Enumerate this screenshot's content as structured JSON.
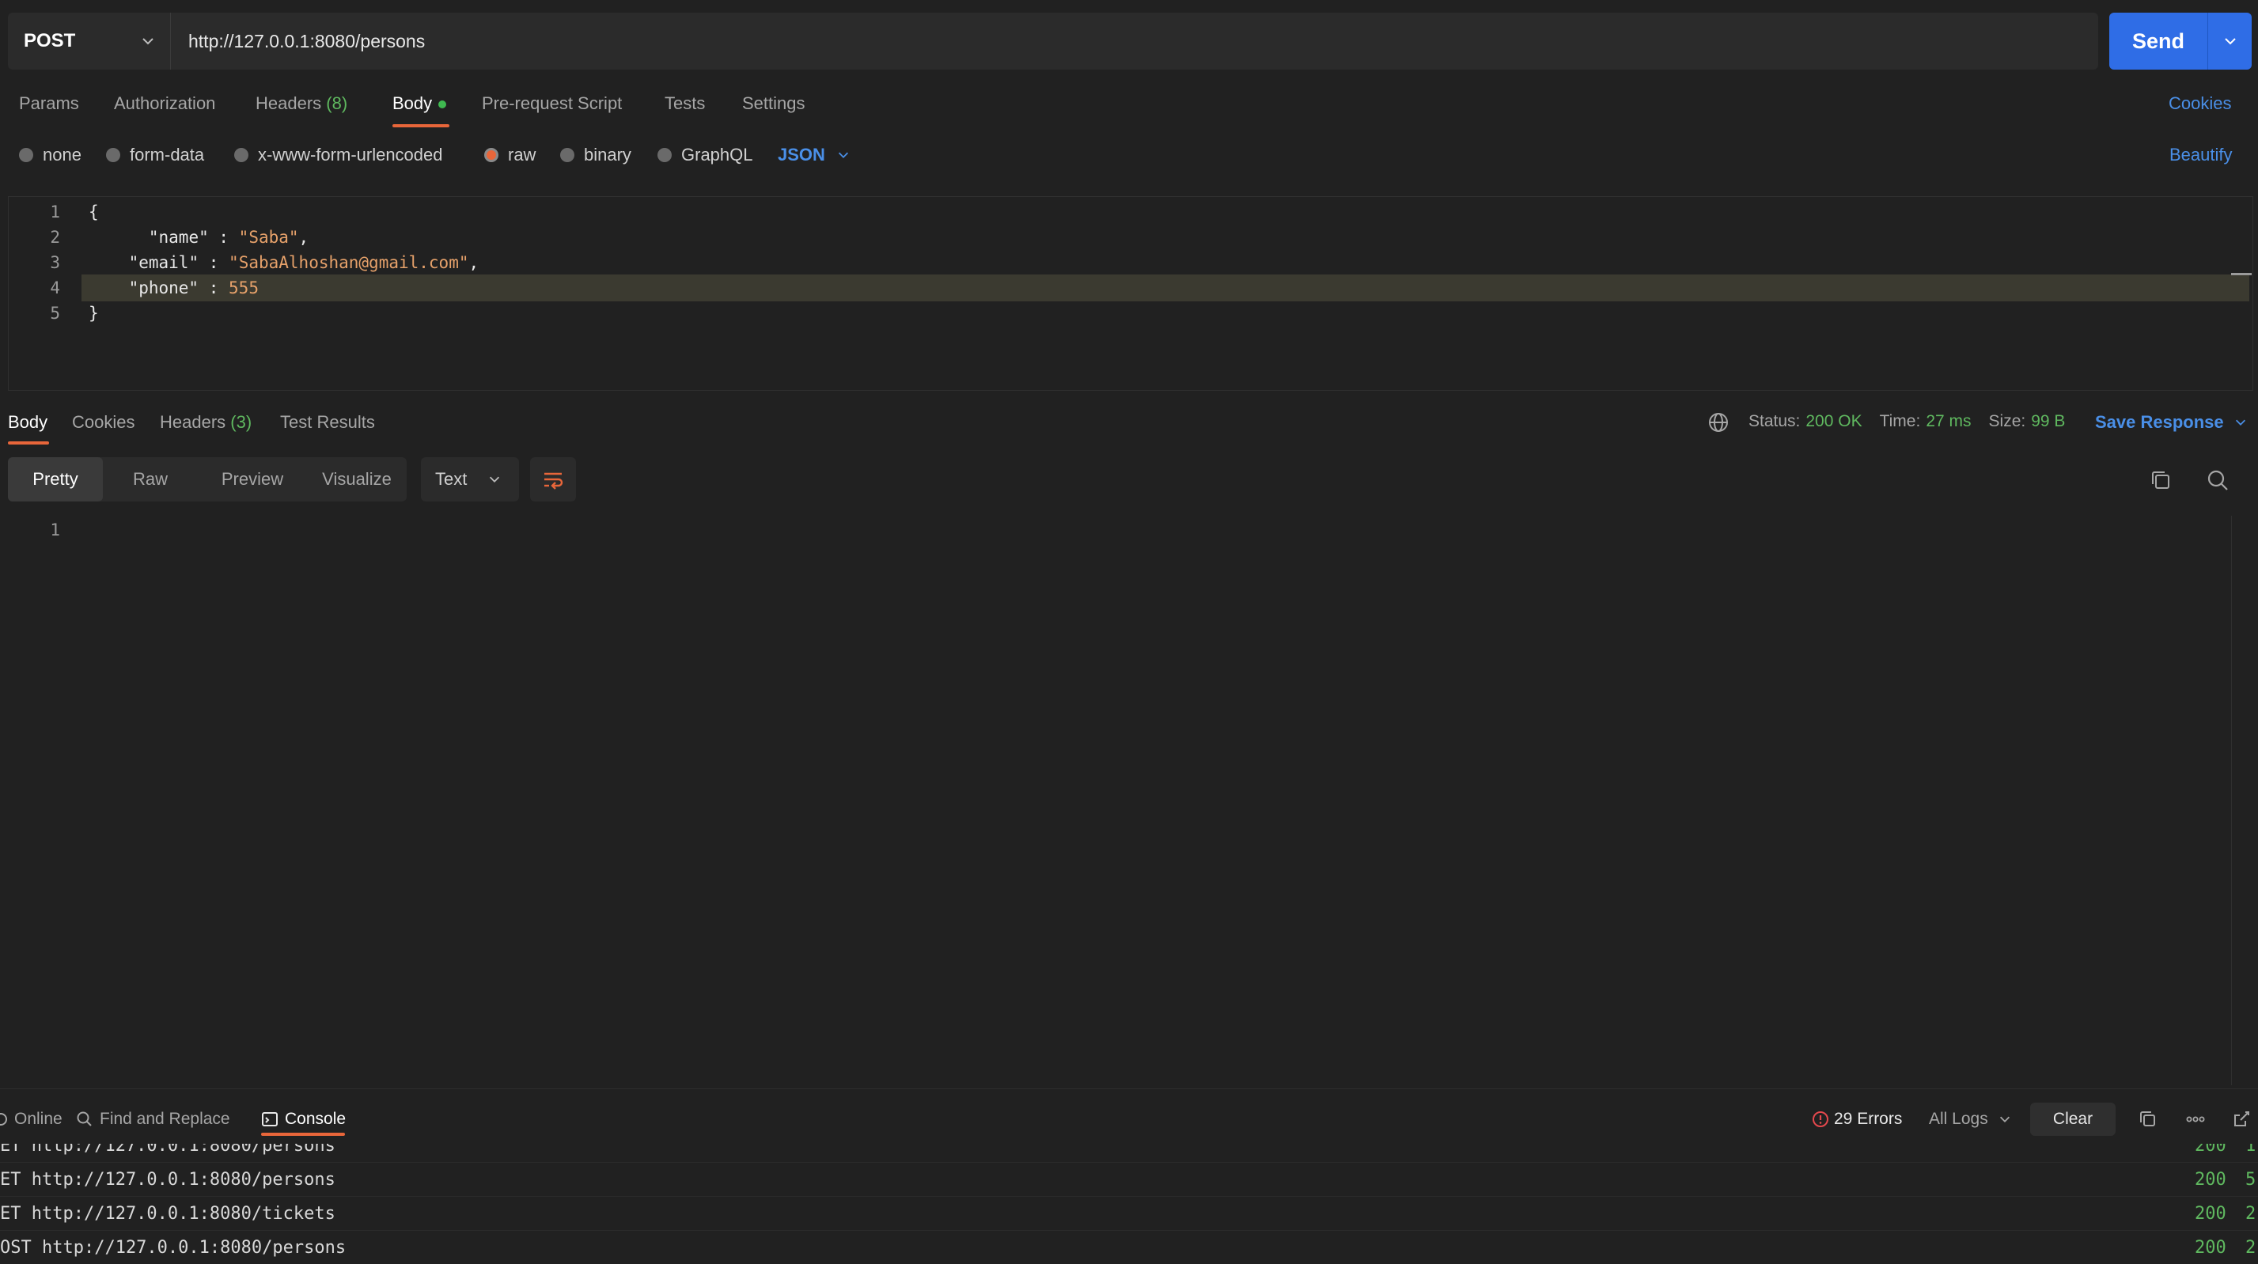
{
  "request": {
    "method": "POST",
    "url": "http://127.0.0.1:8080/persons",
    "send_label": "Send"
  },
  "request_tabs": {
    "params": "Params",
    "authorization": "Authorization",
    "headers": "Headers",
    "headers_count": "(8)",
    "body": "Body",
    "pre_request": "Pre-request Script",
    "tests": "Tests",
    "settings": "Settings",
    "cookies": "Cookies"
  },
  "body_types": {
    "none": "none",
    "form_data": "form-data",
    "urlencoded": "x-www-form-urlencoded",
    "raw": "raw",
    "binary": "binary",
    "graphql": "GraphQL",
    "selected_format": "JSON",
    "beautify": "Beautify"
  },
  "editor": {
    "line_numbers": [
      "1",
      "2",
      "3",
      "4",
      "5"
    ],
    "lines": {
      "l1": "{",
      "l2_key": "\"name\"",
      "l2_sep": " : ",
      "l2_val": "\"Saba\"",
      "l2_end": ",",
      "l3_key": "\"email\"",
      "l3_sep": " : ",
      "l3_val": "\"SabaAlhoshan@gmail.com\"",
      "l3_end": ",",
      "l4_key": "\"phone\"",
      "l4_sep": " : ",
      "l4_val": "555",
      "l5": "}"
    }
  },
  "response_tabs": {
    "body": "Body",
    "cookies": "Cookies",
    "headers": "Headers",
    "headers_count": "(3)",
    "test_results": "Test Results"
  },
  "response_meta": {
    "status_label": "Status:",
    "status_value": "200 OK",
    "time_label": "Time:",
    "time_value": "27 ms",
    "size_label": "Size:",
    "size_value": "99 B",
    "save_response": "Save Response"
  },
  "view_modes": {
    "pretty": "Pretty",
    "raw": "Raw",
    "preview": "Preview",
    "visualize": "Visualize",
    "format": "Text"
  },
  "response_body": {
    "line_numbers": [
      "1"
    ]
  },
  "console": {
    "online": "Online",
    "find_replace": "Find and Replace",
    "console_tab": "Console",
    "errors": "29 Errors",
    "all_logs": "All Logs",
    "clear": "Clear",
    "logs": [
      {
        "text": "ET http://127.0.0.1:8080/persons",
        "status": "200",
        "extra": "1"
      },
      {
        "text": "ET http://127.0.0.1:8080/persons",
        "status": "200",
        "extra": "5"
      },
      {
        "text": "ET http://127.0.0.1:8080/tickets",
        "status": "200",
        "extra": "2"
      },
      {
        "text": "OST http://127.0.0.1:8080/persons",
        "status": "200",
        "extra": "2"
      }
    ]
  },
  "colors": {
    "accent_orange": "#e8663a",
    "link_blue": "#4a8fe7",
    "send_blue": "#2f6de6",
    "success_green": "#5fb85f",
    "background": "#212121"
  }
}
